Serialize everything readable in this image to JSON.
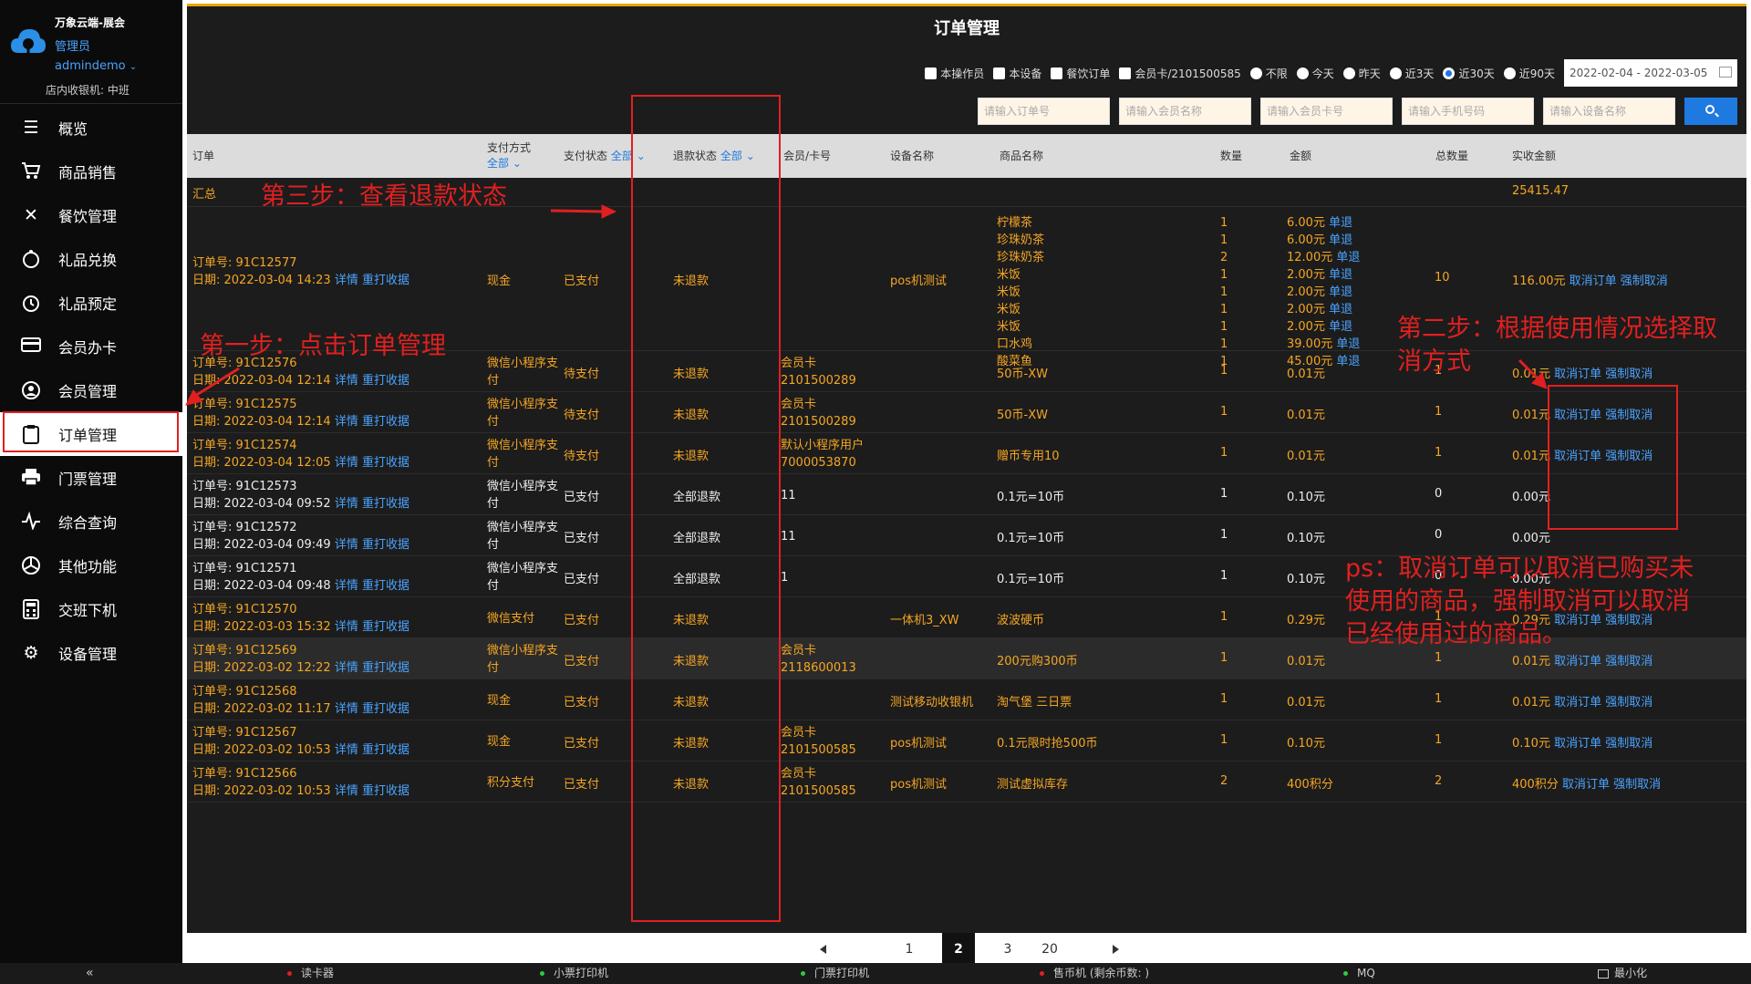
{
  "brand": {
    "company": "万象云端-展会",
    "role": "管理员",
    "user": "admindemo",
    "station": "店内收银机: 中班"
  },
  "nav": [
    {
      "label": "概览",
      "icon": "menu-icon"
    },
    {
      "label": "商品销售",
      "icon": "cart-icon"
    },
    {
      "label": "餐饮管理",
      "icon": "utensils-icon"
    },
    {
      "label": "礼品兑换",
      "icon": "gift-icon"
    },
    {
      "label": "礼品预定",
      "icon": "alarm-clock-icon"
    },
    {
      "label": "会员办卡",
      "icon": "credit-card-icon"
    },
    {
      "label": "会员管理",
      "icon": "user-icon"
    },
    {
      "label": "订单管理",
      "icon": "clipboard-icon",
      "active": true
    },
    {
      "label": "门票管理",
      "icon": "printer-icon"
    },
    {
      "label": "综合查询",
      "icon": "pulse-icon"
    },
    {
      "label": "其他功能",
      "icon": "aperture-icon"
    },
    {
      "label": "交班下机",
      "icon": "calculator-icon"
    },
    {
      "label": "设备管理",
      "icon": "gear-icon"
    }
  ],
  "page_title": "订单管理",
  "filters": {
    "checkboxes": [
      "本操作员",
      "本设备",
      "餐饮订单",
      "会员卡/2101500585"
    ],
    "radios": [
      "不限",
      "今天",
      "昨天",
      "近3天",
      "近30天",
      "近90天"
    ],
    "selected_radio": "近30天",
    "date_range": "2022-02-04 - 2022-03-05"
  },
  "search": {
    "placeholders": [
      "请输入订单号",
      "请输入会员名称",
      "请输入会员卡号",
      "请输入手机号码",
      "请输入设备名称"
    ]
  },
  "table": {
    "headers": {
      "order": "订单",
      "pay_method": "支付方式",
      "pay_method_filter": "全部",
      "pay_status": "支付状态",
      "pay_status_filter": "全部",
      "refund_status": "退款状态",
      "refund_status_filter": "全部",
      "member": "会员/卡号",
      "device": "设备名称",
      "product": "商品名称",
      "qty": "数量",
      "amount": "金额",
      "total_qty": "总数量",
      "paid": "实收金额"
    },
    "summary": {
      "label": "汇总",
      "paid": "25415.47"
    },
    "first_order": {
      "order_no": "订单号: 91C12577",
      "date": "日期: 2022-03-04 14:23",
      "detail": "详情",
      "reprint": "重打收据",
      "pay_method": "现金",
      "pay_status": "已支付",
      "refund_status": "未退款",
      "device": "pos机测试",
      "items": [
        {
          "name": "柠檬茶",
          "qty": "1",
          "amount": "6.00元"
        },
        {
          "name": "珍珠奶茶",
          "qty": "1",
          "amount": "6.00元"
        },
        {
          "name": "珍珠奶茶",
          "qty": "2",
          "amount": "12.00元"
        },
        {
          "name": "米饭",
          "qty": "1",
          "amount": "2.00元"
        },
        {
          "name": "米饭",
          "qty": "1",
          "amount": "2.00元"
        },
        {
          "name": "米饭",
          "qty": "1",
          "amount": "2.00元"
        },
        {
          "name": "米饭",
          "qty": "1",
          "amount": "2.00元"
        },
        {
          "name": "口水鸡",
          "qty": "1",
          "amount": "39.00元"
        },
        {
          "name": "酸菜鱼",
          "qty": "1",
          "amount": "45.00元"
        }
      ],
      "item_refund": "单退",
      "total_qty": "10",
      "paid": "116.00元",
      "cancel": "取消订单",
      "force_cancel": "强制取消"
    },
    "rows": [
      {
        "order_no": "订单号: 91C12576",
        "date": "日期: 2022-03-04 12:14",
        "pay1": "微信小程序支",
        "pay2": "付",
        "pay_status": "待支付",
        "refund": "未退款",
        "m1": "会员卡",
        "m2": "2101500289",
        "device": "",
        "product": "50币-XW",
        "qty": "1",
        "amount": "0.01元",
        "total": "1",
        "paid": "0.01元",
        "cancel": "取消订单",
        "force": "强制取消"
      },
      {
        "order_no": "订单号: 91C12575",
        "date": "日期: 2022-03-04 12:14",
        "pay1": "微信小程序支",
        "pay2": "付",
        "pay_status": "待支付",
        "refund": "未退款",
        "m1": "会员卡",
        "m2": "2101500289",
        "device": "",
        "product": "50币-XW",
        "qty": "1",
        "amount": "0.01元",
        "total": "1",
        "paid": "0.01元",
        "cancel": "取消订单",
        "force": "强制取消"
      },
      {
        "order_no": "订单号: 91C12574",
        "date": "日期: 2022-03-04 12:05",
        "pay1": "微信小程序支",
        "pay2": "付",
        "pay_status": "待支付",
        "refund": "未退款",
        "m1": "默认小程序用户",
        "m2": "7000053870",
        "device": "",
        "product": "赠币专用10",
        "qty": "1",
        "amount": "0.01元",
        "total": "1",
        "paid": "0.01元",
        "cancel": "取消订单",
        "force": "强制取消"
      },
      {
        "order_no": "订单号: 91C12573",
        "date": "日期: 2022-03-04 09:52",
        "pay1": "微信小程序支",
        "pay2": "付",
        "pay_status": "已支付",
        "refund": "全部退款",
        "m1": "11",
        "m2": "",
        "device": "",
        "product": "0.1元=10币",
        "qty": "1",
        "amount": "0.10元",
        "total": "0",
        "paid": "0.00元",
        "cancel": "",
        "force": ""
      },
      {
        "order_no": "订单号: 91C12572",
        "date": "日期: 2022-03-04 09:49",
        "pay1": "微信小程序支",
        "pay2": "付",
        "pay_status": "已支付",
        "refund": "全部退款",
        "m1": "11",
        "m2": "",
        "device": "",
        "product": "0.1元=10币",
        "qty": "1",
        "amount": "0.10元",
        "total": "0",
        "paid": "0.00元",
        "cancel": "",
        "force": ""
      },
      {
        "order_no": "订单号: 91C12571",
        "date": "日期: 2022-03-04 09:48",
        "pay1": "微信小程序支",
        "pay2": "付",
        "pay_status": "已支付",
        "refund": "全部退款",
        "m1": "1",
        "m2": "",
        "device": "",
        "product": "0.1元=10币",
        "qty": "1",
        "amount": "0.10元",
        "total": "0",
        "paid": "0.00元",
        "cancel": "",
        "force": ""
      },
      {
        "order_no": "订单号: 91C12570",
        "date": "日期: 2022-03-03 15:32",
        "pay1": "微信支付",
        "pay2": "",
        "pay_status": "已支付",
        "refund": "未退款",
        "m1": "",
        "m2": "",
        "device": "一体机3_XW",
        "product": "波波硬币",
        "qty": "1",
        "amount": "0.29元",
        "total": "1",
        "paid": "0.29元",
        "cancel": "取消订单",
        "force": "强制取消"
      },
      {
        "order_no": "订单号: 91C12569",
        "date": "日期: 2022-03-02 12:22",
        "pay1": "微信小程序支",
        "pay2": "付",
        "pay_status": "已支付",
        "refund": "未退款",
        "m1": "会员卡",
        "m2": "2118600013",
        "device": "",
        "product": "200元购300币",
        "qty": "1",
        "amount": "0.01元",
        "total": "1",
        "paid": "0.01元",
        "cancel": "取消订单",
        "force": "强制取消"
      },
      {
        "order_no": "订单号: 91C12568",
        "date": "日期: 2022-03-02 11:17",
        "pay1": "现金",
        "pay2": "",
        "pay_status": "已支付",
        "refund": "未退款",
        "m1": "",
        "m2": "",
        "device": "测试移动收银机",
        "product": "淘气堡 三日票",
        "qty": "1",
        "amount": "0.01元",
        "total": "1",
        "paid": "0.01元",
        "cancel": "取消订单",
        "force": "强制取消"
      },
      {
        "order_no": "订单号: 91C12567",
        "date": "日期: 2022-03-02 10:53",
        "pay1": "现金",
        "pay2": "",
        "pay_status": "已支付",
        "refund": "未退款",
        "m1": "会员卡",
        "m2": "2101500585",
        "device": "pos机测试",
        "product": "0.1元限时抢500币",
        "qty": "1",
        "amount": "0.10元",
        "total": "1",
        "paid": "0.10元",
        "cancel": "取消订单",
        "force": "强制取消"
      },
      {
        "order_no": "订单号: 91C12566",
        "date": "日期: 2022-03-02 10:53",
        "pay1": "积分支付",
        "pay2": "",
        "pay_status": "已支付",
        "refund": "未退款",
        "m1": "会员卡",
        "m2": "2101500585",
        "device": "pos机测试",
        "product": "测试虚拟库存",
        "qty": "2",
        "amount": "400积分",
        "total": "2",
        "paid": "400积分",
        "cancel": "取消订单",
        "force": "强制取消"
      }
    ],
    "detail": "详情",
    "reprint": "重打收据"
  },
  "pagination": {
    "pages": [
      "1",
      "2",
      "3",
      "20"
    ],
    "current": "2"
  },
  "statusbar": {
    "collapse": "«",
    "items": [
      "读卡器",
      "小票打印机",
      "门票打印机",
      "售币机 (剩余币数: )",
      "MQ"
    ],
    "minimize": "最小化"
  },
  "annotations": {
    "step3": "第三步：查看退款状态",
    "step1": "第一步：点击订单管理",
    "step2_line1": "第二步：根据使用情况选择取",
    "step2_line2": "消方式",
    "ps_line1": "ps：取消订单可以取消已购买未",
    "ps_line2": "使用的商品，强制取消可以取消",
    "ps_line3": "已经使用过的商品。"
  }
}
